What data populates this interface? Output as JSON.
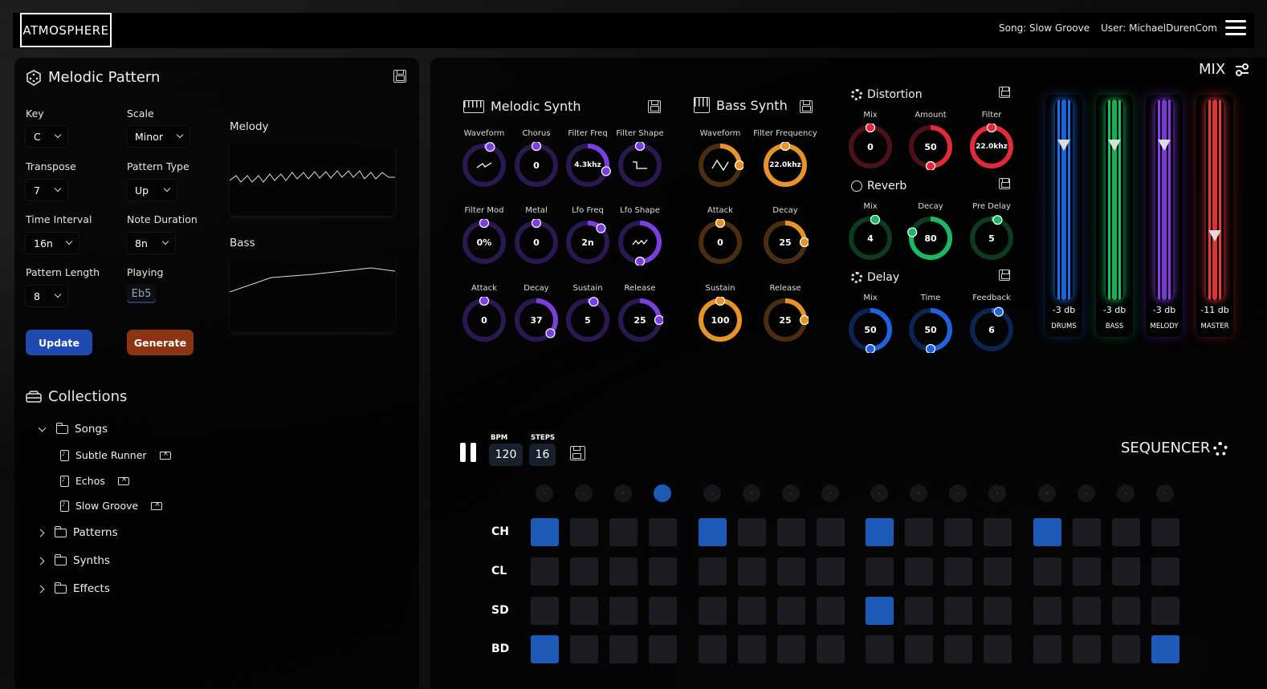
{
  "header": {
    "logo": "ATMOSPHERE",
    "song": "Song: Slow Groove",
    "user": "User: MichaelDurenCom"
  },
  "melodic_pattern": {
    "title": "Melodic Pattern",
    "fields": {
      "key": {
        "label": "Key",
        "value": "C"
      },
      "scale": {
        "label": "Scale",
        "value": "Minor"
      },
      "transpose": {
        "label": "Transpose",
        "value": "7"
      },
      "pattern_type": {
        "label": "Pattern Type",
        "value": "Up"
      },
      "time_interval": {
        "label": "Time Interval",
        "value": "16n"
      },
      "note_duration": {
        "label": "Note Duration",
        "value": "8n"
      },
      "pattern_length": {
        "label": "Pattern Length",
        "value": "8"
      },
      "playing": {
        "label": "Playing",
        "value": "Eb5"
      }
    },
    "update_label": "Update",
    "generate_label": "Generate",
    "melody_label": "Melody",
    "bass_label": "Bass"
  },
  "collections": {
    "title": "Collections",
    "songs_label": "Songs",
    "songs": [
      "Subtle Runner",
      "Echos",
      "Slow Groove"
    ],
    "patterns_label": "Patterns",
    "synths_label": "Synths",
    "effects_label": "Effects"
  },
  "melodic_synth": {
    "title": "Melodic Synth",
    "knobs": [
      {
        "label": "Waveform",
        "value": "",
        "level": 0.05
      },
      {
        "label": "Chorus",
        "value": "0",
        "level": 0.0
      },
      {
        "label": "Filter Freq",
        "value": "4.3khz",
        "level": 0.3
      },
      {
        "label": "Filter Shape",
        "value": "",
        "level": 0.0
      },
      {
        "label": "Filter Mod",
        "value": "0%",
        "level": 0.0
      },
      {
        "label": "Metal",
        "value": "0",
        "level": 0.0
      },
      {
        "label": "Lfo Freq",
        "value": "2n",
        "level": 0.12
      },
      {
        "label": "Lfo Shape",
        "value": "",
        "level": 0.5
      },
      {
        "label": "Attack",
        "value": "0",
        "level": 0.0
      },
      {
        "label": "Decay",
        "value": "37",
        "level": 0.37
      },
      {
        "label": "Sustain",
        "value": "5",
        "level": 0.05
      },
      {
        "label": "Release",
        "value": "25",
        "level": 0.25
      }
    ]
  },
  "bass_synth": {
    "title": "Bass Synth",
    "knobs": [
      {
        "label": "Waveform",
        "value": "",
        "level": 0.25
      },
      {
        "label": "Filter Frequency",
        "value": "22.0khz",
        "level": 1.0
      },
      {
        "label": "Attack",
        "value": "0",
        "level": 0.0
      },
      {
        "label": "Decay",
        "value": "25",
        "level": 0.25
      },
      {
        "label": "Sustain",
        "value": "100",
        "level": 1.0
      },
      {
        "label": "Release",
        "value": "25",
        "level": 0.25
      }
    ]
  },
  "distortion": {
    "title": "Distortion",
    "knobs": [
      {
        "label": "Mix",
        "value": "0",
        "level": 0.0
      },
      {
        "label": "Amount",
        "value": "50",
        "level": 0.5
      },
      {
        "label": "Filter",
        "value": "22.0khz",
        "level": 1.0
      }
    ]
  },
  "reverb": {
    "title": "Reverb",
    "knobs": [
      {
        "label": "Mix",
        "value": "4",
        "level": 0.04
      },
      {
        "label": "Decay",
        "value": "80",
        "level": 0.8
      },
      {
        "label": "Pre Delay",
        "value": "5",
        "level": 0.05
      }
    ]
  },
  "delay": {
    "title": "Delay",
    "knobs": [
      {
        "label": "Mix",
        "value": "50",
        "level": 0.5
      },
      {
        "label": "Time",
        "value": "50",
        "level": 0.5
      },
      {
        "label": "Feedback",
        "value": "6",
        "level": 0.06
      }
    ]
  },
  "mix": {
    "title": "MIX",
    "channels": [
      {
        "name": "DRUMS",
        "db": "-3 db",
        "color": "#1e6ff0",
        "level": 0.8
      },
      {
        "name": "BASS",
        "db": "-3 db",
        "color": "#17c45a",
        "level": 0.8
      },
      {
        "name": "MELODY",
        "db": "-3 db",
        "color": "#8a3cf0",
        "level": 0.8
      },
      {
        "name": "MASTER",
        "db": "-11 db",
        "color": "#f03a3a",
        "level": 0.35
      }
    ]
  },
  "sequencer": {
    "title": "SEQUENCER",
    "bpm_label": "BPM",
    "bpm": "120",
    "steps_label": "STEPS",
    "steps": "16",
    "current_step": 3,
    "rows": [
      {
        "label": "CH",
        "cells": [
          1,
          0,
          0,
          0,
          1,
          0,
          0,
          0,
          1,
          0,
          0,
          0,
          1,
          0,
          0,
          0
        ]
      },
      {
        "label": "CL",
        "cells": [
          0,
          0,
          0,
          0,
          0,
          0,
          0,
          0,
          0,
          0,
          0,
          0,
          0,
          0,
          0,
          0
        ]
      },
      {
        "label": "SD",
        "cells": [
          0,
          0,
          0,
          0,
          0,
          0,
          0,
          0,
          1,
          0,
          0,
          0,
          0,
          0,
          0,
          0
        ]
      },
      {
        "label": "BD",
        "cells": [
          1,
          0,
          0,
          0,
          0,
          0,
          0,
          0,
          0,
          0,
          0,
          0,
          0,
          0,
          0,
          1
        ]
      }
    ]
  },
  "colors": {
    "purple": "#7b3fe0",
    "orange": "#e8922a",
    "red": "#e02a3a",
    "green": "#1ab862",
    "blue": "#1e62e0",
    "step_on": "#1e5ab8"
  }
}
